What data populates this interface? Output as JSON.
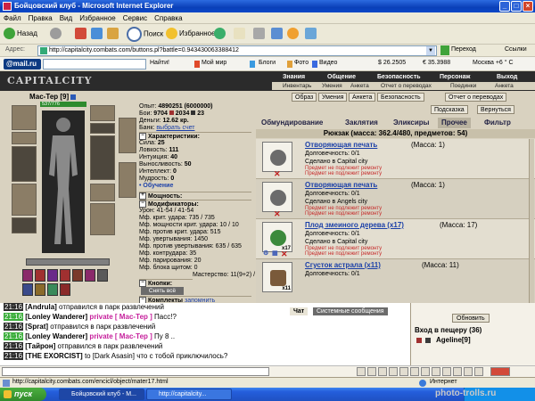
{
  "window": {
    "title": "Бойцовский клуб - Microsoft Internet Explorer"
  },
  "menu": [
    "Файл",
    "Правка",
    "Вид",
    "Избранное",
    "Сервис",
    "Справка"
  ],
  "toolbar": {
    "back": "Назад",
    "search": "Поиск",
    "favorites": "Избранное"
  },
  "address": {
    "label": "Адрес:",
    "url": "http://capitalcity.combats.com/buttons.pl?battle=0.943430063388412",
    "go": "Переход",
    "links": "Ссылки"
  },
  "linkbar": {
    "mail_logo": "@mail.ru",
    "find": "Найти!",
    "items": [
      "Мой мир",
      "Блоги",
      "Фото",
      "Видео"
    ],
    "usd": "$ 26.2505",
    "eur": "€ 35.3988",
    "weather": "Москва +6 ° С"
  },
  "game": {
    "logo": "CAPITALCITY",
    "top_nav": [
      "Знания",
      "Общение",
      "Безопасность",
      "Персонаж",
      "Выход"
    ],
    "sub_nav": [
      "Инвентарь",
      "Умения",
      "Анкета",
      "Отчет о переводах",
      "Поединки",
      "Анкета"
    ]
  },
  "character": {
    "name": "Мас-Тер",
    "level": "[9]",
    "hp": "537/776",
    "exp_label": "Опыт:",
    "exp": "4890251 (6000000)",
    "fights_label": "Бои:",
    "fights": "9704",
    "wins": "2034",
    "losses": "23",
    "money_label": "Деньги:",
    "money": "12.62 кр.",
    "bank_label": "Банк:",
    "bank": "выбрать счет",
    "characteristics_label": "Характеристики:",
    "stats": [
      {
        "label": "Сила:",
        "value": "25"
      },
      {
        "label": "Ловкость:",
        "value": "111"
      },
      {
        "label": "Интуиция:",
        "value": "40"
      },
      {
        "label": "Выносливость:",
        "value": "50"
      },
      {
        "label": "Интеллект:",
        "value": "0"
      },
      {
        "label": "Мудрость:",
        "value": "0"
      }
    ],
    "training": "• Обучение",
    "power_label": "Мощность:",
    "modifiers_label": "Модификаторы:",
    "damage_line": "Урон: 41-54 / 41-54",
    "modifiers": [
      "Мф. крит. удара: 735 / 735",
      "Мф. мощности крит. удара: 10 / 10",
      "Мф. против крит. удара: 515",
      "Мф. увертывания: 1450",
      "Мф. против увертывания: 635 / 635",
      "Мф. контрудара: 35",
      "Мф. парирования: 20",
      "Мф. блока щитом: 0",
      "Мастерство: 11(9+2) / 11(9+2)"
    ],
    "buttons_label": "Кнопки:",
    "dress_all": "Снять всё",
    "sets_label": "Комплекты",
    "remember": "запомнить",
    "set_item": "Надеть \"Мас-Тер...\""
  },
  "inventory": {
    "top_buttons": [
      "Образ",
      "Умения",
      "Анкета",
      "Безопасность",
      "Отчет о переводах"
    ],
    "sub_buttons": [
      "Подсказка",
      "Вернуться"
    ],
    "tabs": [
      "Обмундирование",
      "Заклятия",
      "Эликсиры",
      "Прочее",
      "Фильтр"
    ],
    "backpack": "Рюкзак (масса: 362.4/480, предметов: 54)",
    "items": [
      {
        "name": "Отворяющая печать",
        "mass": "(Масса: 1)",
        "durability": "Долговечность: 0/1",
        "made": "Сделано в Capital city",
        "warn1": "Предмет не подлежит ремонту",
        "warn2": "Предмет не подлежит ремонту",
        "qty": "",
        "color": "#6B6B6B"
      },
      {
        "name": "Отворяющая печать",
        "mass": "(Масса: 1)",
        "durability": "Долговечность: 0/1",
        "made": "Сделано в Angels city",
        "warn1": "Предмет не подлежит ремонту",
        "warn2": "Предмет не подлежит ремонту",
        "qty": "",
        "color": "#6B6B6B"
      },
      {
        "name": "Плод змеиного дерева (x17)",
        "mass": "(Масса: 17)",
        "durability": "Долговечность: 0/1",
        "made": "Сделано в Capital city",
        "warn1": "Предмет не подлежит ремонту",
        "warn2": "Предмет не подлежит ремонту",
        "qty": "x17",
        "color": "#3C8A3C"
      },
      {
        "name": "Сгусток астрала (x11)",
        "mass": "(Масса: 11)",
        "durability": "Долговечность: 0/1",
        "made": "",
        "warn1": "",
        "warn2": "",
        "qty": "x11",
        "color": "#7A5A3A"
      }
    ]
  },
  "chat": {
    "tabs": [
      "Чат",
      "Системные сообщения"
    ],
    "lines": [
      {
        "time": "21:16",
        "parts": [
          [
            "nm",
            "[Andrula]"
          ],
          [
            "tx",
            " отправился в парк развлечений"
          ]
        ],
        "green": false
      },
      {
        "time": "21:16",
        "parts": [
          [
            "nm",
            "[Lonley Wanderer]"
          ],
          [
            "pv",
            " private [ Мас-Тер ]"
          ],
          [
            "tx",
            " Пасс!?"
          ]
        ],
        "green": true
      },
      {
        "time": "21:16",
        "parts": [
          [
            "nm",
            "[Sprat]"
          ],
          [
            "tx",
            " отправился в парк развлечений"
          ]
        ],
        "green": false
      },
      {
        "time": "21:16",
        "parts": [
          [
            "nm",
            "[Lonley Wanderer]"
          ],
          [
            "pv",
            " private [ Мас-Тер ]"
          ],
          [
            "tx",
            " Пу 8 .."
          ]
        ],
        "green": true
      },
      {
        "time": "21:16",
        "parts": [
          [
            "nm",
            "[Тайрон]"
          ],
          [
            "tx",
            " отправился в парк развлечений"
          ]
        ],
        "green": false
      },
      {
        "time": "21:16",
        "parts": [
          [
            "nm",
            "[THE EXORCIST]"
          ],
          [
            "tx",
            " to [Dark Asasin] что с тобой приключилось?"
          ]
        ],
        "green": false
      }
    ],
    "refresh": "Обновить",
    "location": "Вход в пещеру (36)",
    "user": "Ageline[9]"
  },
  "statusbar": {
    "url": "http://capitalcity.combats.com/encicl/object/mater17.html",
    "zone": "Интернет"
  },
  "taskbar": {
    "start": "пуск",
    "tasks": [
      "Бойцовский клуб - M...",
      "http://capitalcity..."
    ]
  },
  "watermark": "photo-trolls.ru"
}
